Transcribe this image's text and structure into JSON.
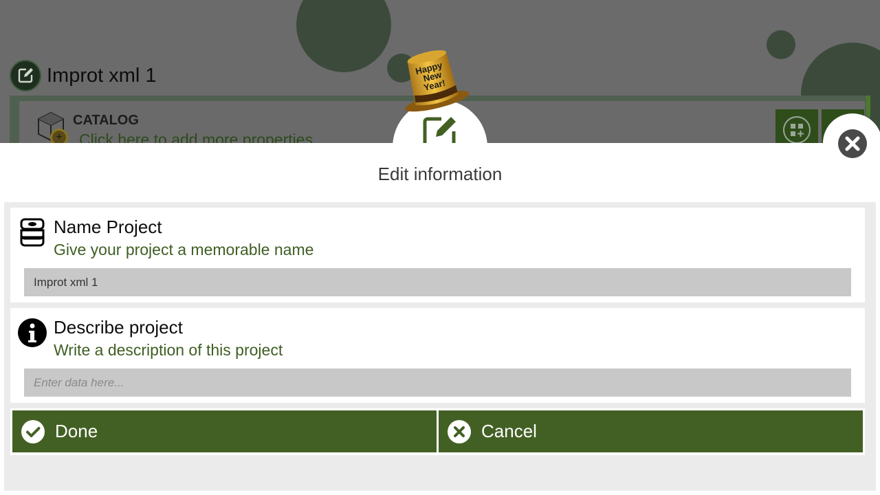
{
  "background": {
    "project_title": "Improt xml 1",
    "catalog_heading": "CATALOG",
    "catalog_link": "Click here to add more properties",
    "add_badge": "+"
  },
  "hat": {
    "line1": "Happy",
    "line2": "New",
    "line3": "Year!"
  },
  "modal": {
    "title": "Edit information",
    "icon": "edit-icon",
    "close_icon": "close-icon"
  },
  "form": {
    "name_section": {
      "icon": "database-icon",
      "title": "Name Project",
      "subtitle": "Give your project a memorable name",
      "value": "Improt xml 1",
      "placeholder": ""
    },
    "describe_section": {
      "icon": "info-icon",
      "title": "Describe project",
      "subtitle": "Write a description of this project",
      "value": "",
      "placeholder": "Enter data here..."
    }
  },
  "actions": {
    "done_label": "Done",
    "done_icon": "check-circle-icon",
    "cancel_label": "Cancel",
    "cancel_icon": "x-circle-icon"
  },
  "colors": {
    "accent_green": "#436024",
    "subtitle_green": "#3f5e23",
    "field_bg": "#c8c8c8",
    "overlay_gray": "#6b6b6b"
  }
}
